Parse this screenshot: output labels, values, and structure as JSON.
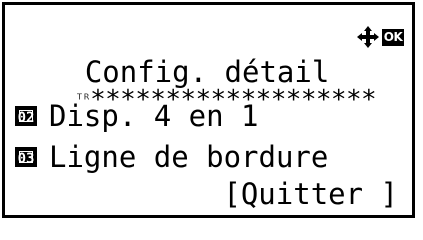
{
  "header": {
    "title": "Config. détail",
    "nav_icon": "four-way-arrow-icon",
    "ok_label": "OK"
  },
  "divider": {
    "prefix": "ᵀᴿ",
    "stars": "*******************"
  },
  "menu": {
    "items": [
      {
        "number": "02",
        "label": "Disp. 4 en 1"
      },
      {
        "number": "03",
        "label": "Ligne de bordure"
      }
    ]
  },
  "footer": {
    "quit_label": "[Quitter ]"
  }
}
